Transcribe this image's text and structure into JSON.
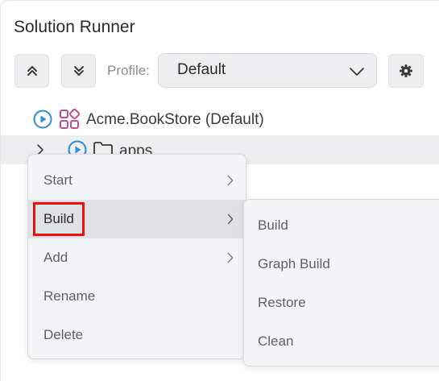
{
  "panel": {
    "title": "Solution Runner"
  },
  "toolbar": {
    "expand_all_icon": "double-chevron-up-icon",
    "collapse_all_icon": "double-chevron-down-icon",
    "profile_label": "Profile:",
    "profile_value": "Default",
    "settings_icon": "gear-icon"
  },
  "tree": {
    "solution": {
      "label": "Acme.BookStore (Default)",
      "icon": "solution-icon",
      "run_icon": "play-circle-icon"
    },
    "folder": {
      "label": "apps",
      "icon": "folder-icon",
      "run_icon": "play-circle-icon",
      "expander_icon": "chevron-right-icon"
    }
  },
  "context_menu": {
    "items": [
      {
        "label": "Start",
        "has_submenu": true
      },
      {
        "label": "Build",
        "has_submenu": true,
        "highlighted": true
      },
      {
        "label": "Add",
        "has_submenu": true
      },
      {
        "label": "Rename",
        "has_submenu": false
      },
      {
        "label": "Delete",
        "has_submenu": false
      }
    ]
  },
  "build_submenu": {
    "items": [
      {
        "label": "Build"
      },
      {
        "label": "Graph Build"
      },
      {
        "label": "Restore"
      },
      {
        "label": "Clean"
      }
    ]
  },
  "colors": {
    "accent_blue": "#2a8fd6",
    "solution_icon": "#c04a8e",
    "highlight_red": "#e8130f",
    "panel_bg": "#ffffff",
    "menu_bg": "#f3f4f6"
  }
}
